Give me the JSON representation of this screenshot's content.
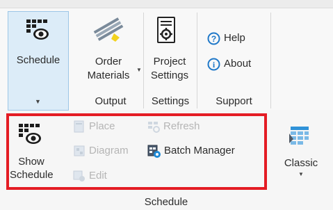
{
  "ribbon": {
    "schedule_button": {
      "label": "Schedule",
      "icon": "schedule-grid-eye-icon"
    },
    "order_materials": {
      "line1": "Order",
      "line2": "Materials",
      "icon": "materials-beams-icon"
    },
    "project_settings": {
      "line1": "Project",
      "line2": "Settings",
      "icon": "settings-document-gear-icon"
    },
    "help_label": "Help",
    "about_label": "About",
    "groups": {
      "output": "Output",
      "settings": "Settings",
      "support": "Support"
    }
  },
  "schedule_panel": {
    "show_schedule": {
      "line1": "Show",
      "line2": "Schedule",
      "icon": "schedule-grid-eye-icon"
    },
    "place_label": "Place",
    "diagram_label": "Diagram",
    "edit_label": "Edit",
    "refresh_label": "Refresh",
    "batch_manager_label": "Batch Manager",
    "classic_label": "Classic",
    "group_label": "Schedule"
  },
  "colors": {
    "highlight_border": "#e41c24",
    "selected_button_bg": "#dcecf8",
    "info_blue": "#1f78c8",
    "disabled_text": "#b5b5b5"
  }
}
